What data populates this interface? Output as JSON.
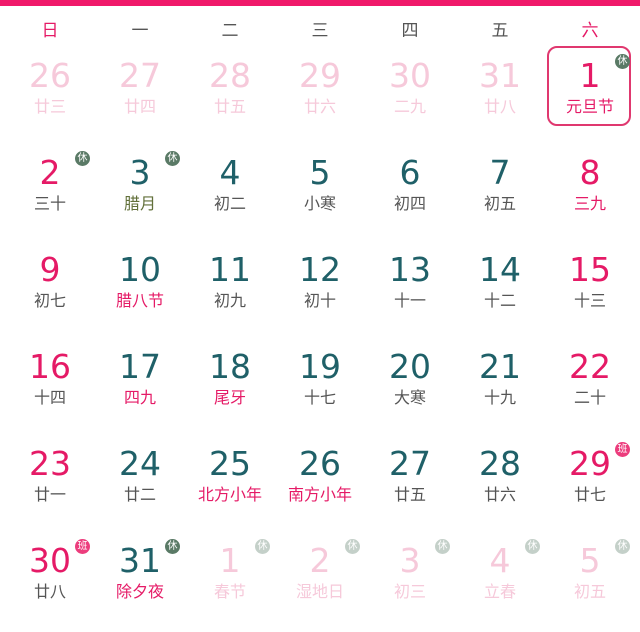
{
  "weekdays": [
    "日",
    "一",
    "二",
    "三",
    "四",
    "五",
    "六"
  ],
  "badges": {
    "rest": "休",
    "work": "班"
  },
  "weeks": [
    [
      {
        "num": "26",
        "sub": "廿三",
        "faded": true
      },
      {
        "num": "27",
        "sub": "廿四",
        "faded": true
      },
      {
        "num": "28",
        "sub": "廿五",
        "faded": true
      },
      {
        "num": "29",
        "sub": "廿六",
        "faded": true
      },
      {
        "num": "30",
        "sub": "二九",
        "faded": true
      },
      {
        "num": "31",
        "sub": "廿八",
        "faded": true
      },
      {
        "num": "1",
        "sub": "元旦节",
        "color": "pink",
        "subColor": "pink",
        "badge": "rest",
        "selected": true
      }
    ],
    [
      {
        "num": "2",
        "sub": "三十",
        "color": "pink",
        "subColor": "gray",
        "badge": "rest"
      },
      {
        "num": "3",
        "sub": "腊月",
        "color": "teal",
        "subColor": "olive",
        "badge": "rest"
      },
      {
        "num": "4",
        "sub": "初二",
        "color": "teal",
        "subColor": "gray"
      },
      {
        "num": "5",
        "sub": "小寒",
        "color": "teal",
        "subColor": "gray"
      },
      {
        "num": "6",
        "sub": "初四",
        "color": "teal",
        "subColor": "gray"
      },
      {
        "num": "7",
        "sub": "初五",
        "color": "teal",
        "subColor": "gray"
      },
      {
        "num": "8",
        "sub": "三九",
        "color": "pink",
        "subColor": "pink"
      }
    ],
    [
      {
        "num": "9",
        "sub": "初七",
        "color": "pink",
        "subColor": "gray"
      },
      {
        "num": "10",
        "sub": "腊八节",
        "color": "teal",
        "subColor": "pink"
      },
      {
        "num": "11",
        "sub": "初九",
        "color": "teal",
        "subColor": "gray"
      },
      {
        "num": "12",
        "sub": "初十",
        "color": "teal",
        "subColor": "gray"
      },
      {
        "num": "13",
        "sub": "十一",
        "color": "teal",
        "subColor": "gray"
      },
      {
        "num": "14",
        "sub": "十二",
        "color": "teal",
        "subColor": "gray"
      },
      {
        "num": "15",
        "sub": "十三",
        "color": "pink",
        "subColor": "gray"
      }
    ],
    [
      {
        "num": "16",
        "sub": "十四",
        "color": "pink",
        "subColor": "gray"
      },
      {
        "num": "17",
        "sub": "四九",
        "color": "teal",
        "subColor": "pink"
      },
      {
        "num": "18",
        "sub": "尾牙",
        "color": "teal",
        "subColor": "pink"
      },
      {
        "num": "19",
        "sub": "十七",
        "color": "teal",
        "subColor": "gray"
      },
      {
        "num": "20",
        "sub": "大寒",
        "color": "teal",
        "subColor": "gray"
      },
      {
        "num": "21",
        "sub": "十九",
        "color": "teal",
        "subColor": "gray"
      },
      {
        "num": "22",
        "sub": "二十",
        "color": "pink",
        "subColor": "gray"
      }
    ],
    [
      {
        "num": "23",
        "sub": "廿一",
        "color": "pink",
        "subColor": "gray"
      },
      {
        "num": "24",
        "sub": "廿二",
        "color": "teal",
        "subColor": "gray"
      },
      {
        "num": "25",
        "sub": "北方小年",
        "color": "teal",
        "subColor": "pink"
      },
      {
        "num": "26",
        "sub": "南方小年",
        "color": "teal",
        "subColor": "pink"
      },
      {
        "num": "27",
        "sub": "廿五",
        "color": "teal",
        "subColor": "gray"
      },
      {
        "num": "28",
        "sub": "廿六",
        "color": "teal",
        "subColor": "gray"
      },
      {
        "num": "29",
        "sub": "廿七",
        "color": "pink",
        "subColor": "gray",
        "badge": "work"
      }
    ],
    [
      {
        "num": "30",
        "sub": "廿八",
        "color": "pink",
        "subColor": "gray",
        "badge": "work"
      },
      {
        "num": "31",
        "sub": "除夕夜",
        "color": "teal",
        "subColor": "pink",
        "badge": "rest"
      },
      {
        "num": "1",
        "sub": "春节",
        "faded": true,
        "badge": "rest"
      },
      {
        "num": "2",
        "sub": "湿地日",
        "faded": true,
        "badge": "rest"
      },
      {
        "num": "3",
        "sub": "初三",
        "faded": true,
        "badge": "rest"
      },
      {
        "num": "4",
        "sub": "立春",
        "faded": true,
        "badge": "rest"
      },
      {
        "num": "5",
        "sub": "初五",
        "faded": true,
        "badge": "rest"
      }
    ]
  ],
  "colors": {
    "accent": "#e51a66",
    "teal": "#1f6068",
    "rest_badge": "#5a7a66",
    "work_badge": "#ec3d7d"
  }
}
